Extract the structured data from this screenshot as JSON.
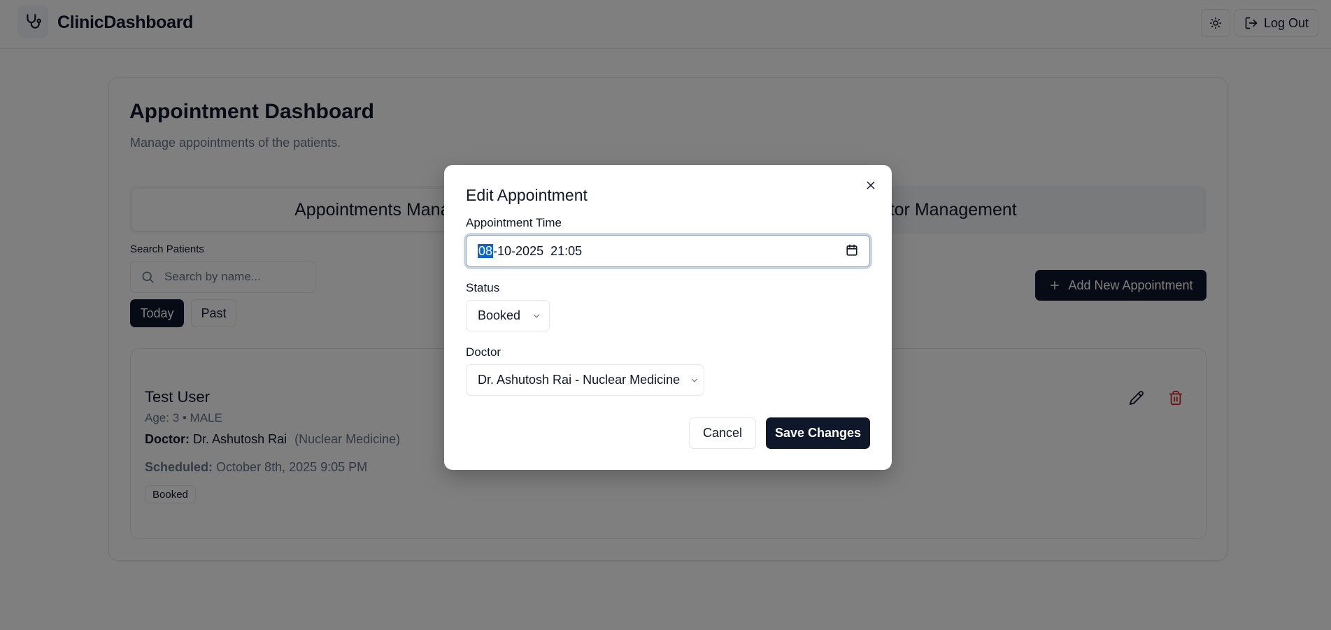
{
  "header": {
    "app_title": "ClinicDashboard",
    "logo_icon": "stethoscope-icon",
    "theme_icon": "sun-icon",
    "logout_label": "Log Out"
  },
  "main": {
    "title": "Appointment Dashboard",
    "subtitle": "Manage appointments of the patients.",
    "tabs": [
      {
        "label": "Appointments Management",
        "active": true
      },
      {
        "label": "Doctor Management",
        "active": false
      }
    ],
    "search": {
      "label": "Search Patients",
      "placeholder": "Search by name...",
      "value": ""
    },
    "filters": [
      {
        "label": "Today",
        "active": true
      },
      {
        "label": "Past",
        "active": false
      }
    ],
    "add_button_label": "Add New Appointment",
    "appointments": [
      {
        "name": "Test User",
        "age_line": "Age: 3 • MALE",
        "doctor_label": "Doctor:",
        "doctor_name": "Dr. Ashutosh Rai",
        "specialty": "(Nuclear Medicine)",
        "scheduled_label": "Scheduled:",
        "scheduled_value": "October 8th, 2025 9:05 PM",
        "status": "Booked"
      }
    ]
  },
  "modal": {
    "title": "Edit Appointment",
    "time_label": "Appointment Time",
    "time_value": {
      "day": "08",
      "rest": "-10-2025  21:05"
    },
    "status_label": "Status",
    "status_value": "Booked",
    "doctor_label": "Doctor",
    "doctor_value": "Dr. Ashutosh Rai - Nuclear Medicine",
    "cancel_label": "Cancel",
    "save_label": "Save Changes"
  },
  "colors": {
    "primary": "#0f172a",
    "muted": "#64748b",
    "danger": "#dc2626",
    "overlay": "rgba(0,0,0,0.5)",
    "selection": "#0b63ce"
  }
}
